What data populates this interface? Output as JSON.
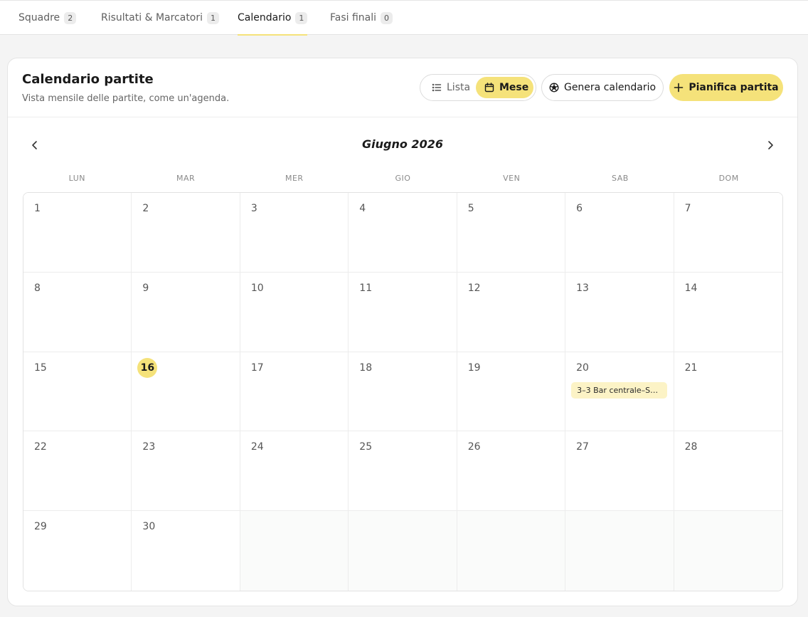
{
  "tabs": [
    {
      "label": "Squadre",
      "count": "2"
    },
    {
      "label": "Risultati & Marcatori",
      "count": "1"
    },
    {
      "label": "Calendario",
      "count": "1"
    },
    {
      "label": "Fasi finali",
      "count": "0"
    }
  ],
  "colors": {
    "accent": "#f5e27a",
    "event_bg": "#fcf3c6",
    "page_bg": "#f4f4f4"
  },
  "card": {
    "title": "Calendario partite",
    "subtitle": "Vista mensile delle partite, come un'agenda.",
    "view_toggle": {
      "list_label": "Lista",
      "month_label": "Mese",
      "selected": "Mese"
    },
    "generate_label": "Genera calendario",
    "schedule_label": "Pianifica partita"
  },
  "calendar": {
    "month_label": "Giugno 2026",
    "weekdays": [
      "LUN",
      "MAR",
      "MER",
      "GIO",
      "VEN",
      "SAB",
      "DOM"
    ],
    "days": [
      "1",
      "2",
      "3",
      "4",
      "5",
      "6",
      "7",
      "8",
      "9",
      "10",
      "11",
      "12",
      "13",
      "14",
      "15",
      "16",
      "17",
      "18",
      "19",
      "20",
      "21",
      "22",
      "23",
      "24",
      "25",
      "26",
      "27",
      "28",
      "29",
      "30",
      "",
      "",
      "",
      "",
      ""
    ],
    "today": "16",
    "event": {
      "day": "20",
      "label": "3–3 Bar centrale–S…"
    }
  }
}
